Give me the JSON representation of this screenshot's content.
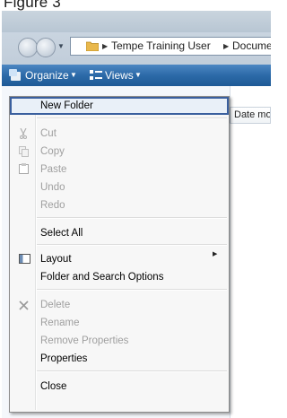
{
  "caption": "Figure 3",
  "window": {
    "breadcrumb": [
      "Tempe Training User",
      "Documents"
    ]
  },
  "toolbar": {
    "organize_label": "Organize",
    "views_label": "Views",
    "dropdown_glyph": "▼"
  },
  "file_list": {
    "column_header": "Date modified"
  },
  "menu": {
    "items": [
      {
        "label": "New Folder",
        "enabled": true,
        "icon": null,
        "highlighted": true
      },
      {
        "label": "Cut",
        "enabled": false,
        "icon": "scissors-icon"
      },
      {
        "label": "Copy",
        "enabled": false,
        "icon": "copy-icon"
      },
      {
        "label": "Paste",
        "enabled": false,
        "icon": "paste-icon"
      },
      {
        "label": "Undo",
        "enabled": false,
        "icon": null
      },
      {
        "label": "Redo",
        "enabled": false,
        "icon": null
      },
      {
        "label": "Select All",
        "enabled": true,
        "icon": null
      },
      {
        "label": "Layout",
        "enabled": true,
        "icon": "layout-icon",
        "submenu": true
      },
      {
        "label": "Folder and Search Options",
        "enabled": true,
        "icon": null
      },
      {
        "label": "Delete",
        "enabled": false,
        "icon": "delete-x-icon"
      },
      {
        "label": "Rename",
        "enabled": false,
        "icon": null
      },
      {
        "label": "Remove Properties",
        "enabled": false,
        "icon": null
      },
      {
        "label": "Properties",
        "enabled": true,
        "icon": null
      },
      {
        "label": "Close",
        "enabled": true,
        "icon": null
      }
    ],
    "submenu_glyph": "▶"
  },
  "colors": {
    "toolbar": "#2c6aa8",
    "highlight_border": "#3a5f9e",
    "disabled_text": "#9f9f9f"
  }
}
